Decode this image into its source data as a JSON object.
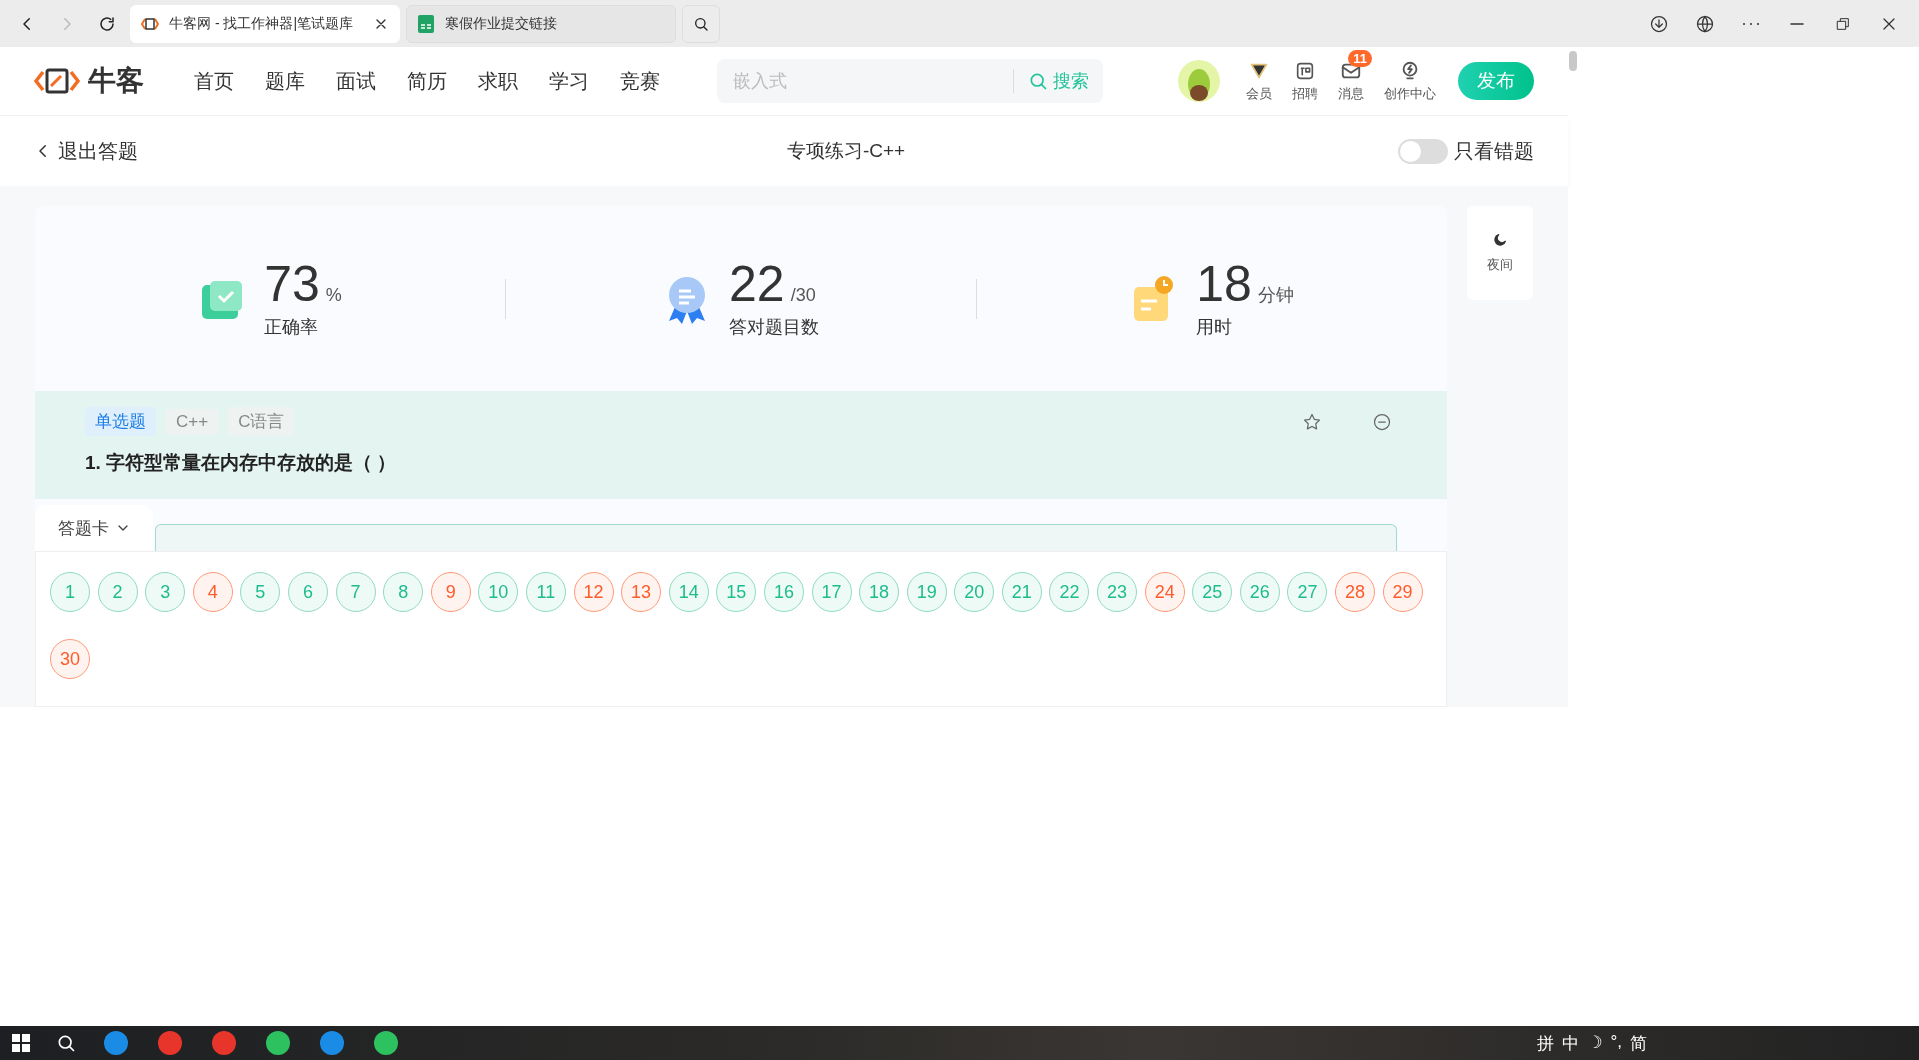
{
  "browser": {
    "tabs": [
      {
        "title": "牛客网 - 找工作神器|笔试题库",
        "selected": true,
        "closable": true,
        "kind": "site"
      },
      {
        "title": "寒假作业提交链接",
        "selected": false,
        "closable": false,
        "kind": "sheet"
      }
    ]
  },
  "site_nav": {
    "logo": "牛客",
    "links": [
      "首页",
      "题库",
      "面试",
      "简历",
      "求职",
      "学习",
      "竞赛"
    ],
    "search": {
      "placeholder": "嵌入式",
      "button": "搜索"
    },
    "tools": [
      {
        "label": "会员",
        "kind": "vip"
      },
      {
        "label": "招聘",
        "kind": "jobs"
      },
      {
        "label": "消息",
        "kind": "mail",
        "badge": "11"
      },
      {
        "label": "创作中心",
        "kind": "bulb"
      }
    ],
    "publish": "发布"
  },
  "sub_header": {
    "back": "退出答题",
    "title": "专项练习-C++",
    "wrong_only": {
      "label": "只看错题",
      "on": false
    }
  },
  "stats": [
    {
      "value": "73",
      "unit": "%",
      "label": "正确率",
      "kind": "rate"
    },
    {
      "value": "22",
      "unit": "/30",
      "label": "答对题目数",
      "kind": "count"
    },
    {
      "value": "18",
      "unit": "分钟",
      "label": "用时",
      "kind": "time"
    }
  ],
  "night_mode": "夜间",
  "question": {
    "tags": [
      {
        "label": "单选题",
        "kind": "type"
      },
      {
        "label": "C++",
        "kind": "topic"
      },
      {
        "label": "C语言",
        "kind": "topic"
      }
    ],
    "text": "1. 字符型常量在内存中存放的是（ ）"
  },
  "answer_card": {
    "title": "答题卡",
    "items": [
      {
        "n": "1",
        "correct": true
      },
      {
        "n": "2",
        "correct": true
      },
      {
        "n": "3",
        "correct": true
      },
      {
        "n": "4",
        "correct": false
      },
      {
        "n": "5",
        "correct": true
      },
      {
        "n": "6",
        "correct": true
      },
      {
        "n": "7",
        "correct": true
      },
      {
        "n": "8",
        "correct": true
      },
      {
        "n": "9",
        "correct": false
      },
      {
        "n": "10",
        "correct": true
      },
      {
        "n": "11",
        "correct": true
      },
      {
        "n": "12",
        "correct": false
      },
      {
        "n": "13",
        "correct": false
      },
      {
        "n": "14",
        "correct": true
      },
      {
        "n": "15",
        "correct": true
      },
      {
        "n": "16",
        "correct": true
      },
      {
        "n": "17",
        "correct": true
      },
      {
        "n": "18",
        "correct": true
      },
      {
        "n": "19",
        "correct": true
      },
      {
        "n": "20",
        "correct": true
      },
      {
        "n": "21",
        "correct": true
      },
      {
        "n": "22",
        "correct": true
      },
      {
        "n": "23",
        "correct": true
      },
      {
        "n": "24",
        "correct": false
      },
      {
        "n": "25",
        "correct": true
      },
      {
        "n": "26",
        "correct": true
      },
      {
        "n": "27",
        "correct": true
      },
      {
        "n": "28",
        "correct": false
      },
      {
        "n": "29",
        "correct": false
      },
      {
        "n": "30",
        "correct": false
      }
    ]
  },
  "taskbar": {
    "tray": [
      "拼",
      "中",
      "☽",
      "°,",
      "简"
    ]
  }
}
